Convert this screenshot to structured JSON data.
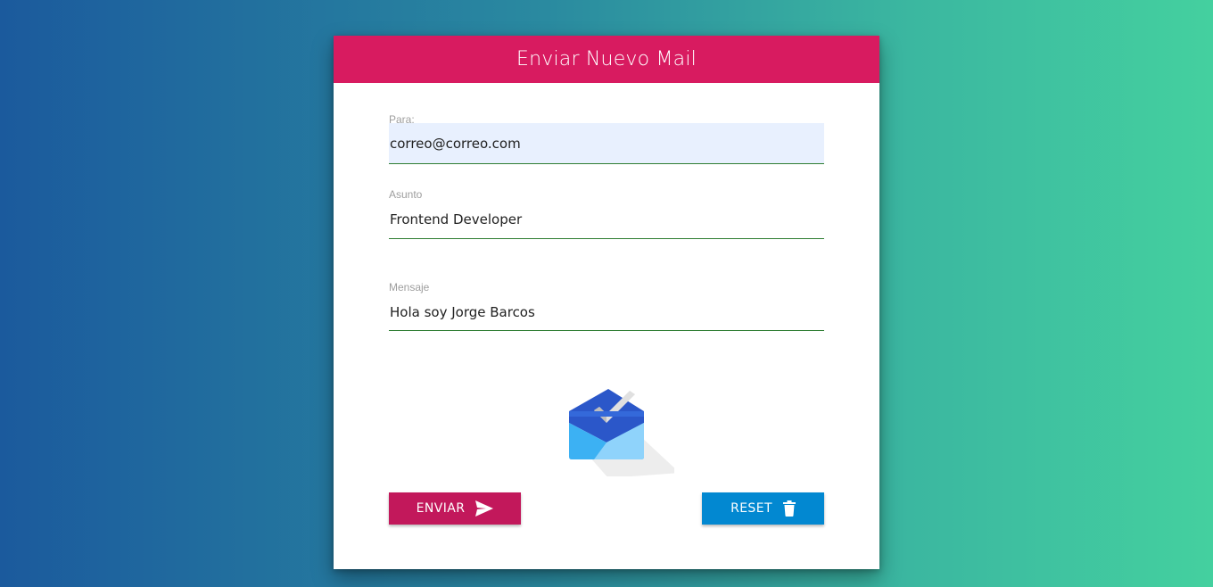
{
  "card": {
    "title": "Enviar Nuevo Mail"
  },
  "form": {
    "to_label": "Para:",
    "to_value": "correo@correo.com",
    "subject_label": "Asunto",
    "subject_value": "Frontend Developer",
    "message_label": "Mensaje",
    "message_value": "Hola soy Jorge Barcos"
  },
  "buttons": {
    "send_label": "ENVIAR",
    "send_icon": "send-icon",
    "reset_label": "RESET",
    "reset_icon": "delete-icon"
  },
  "logo": {
    "icon": "inbox-mail-icon"
  },
  "colors": {
    "header": "#d81b60",
    "send_button": "#c2185b",
    "reset_button": "#0288d1",
    "input_underline": "#2e7d32",
    "autofill_bg": "#e8f0fe"
  }
}
